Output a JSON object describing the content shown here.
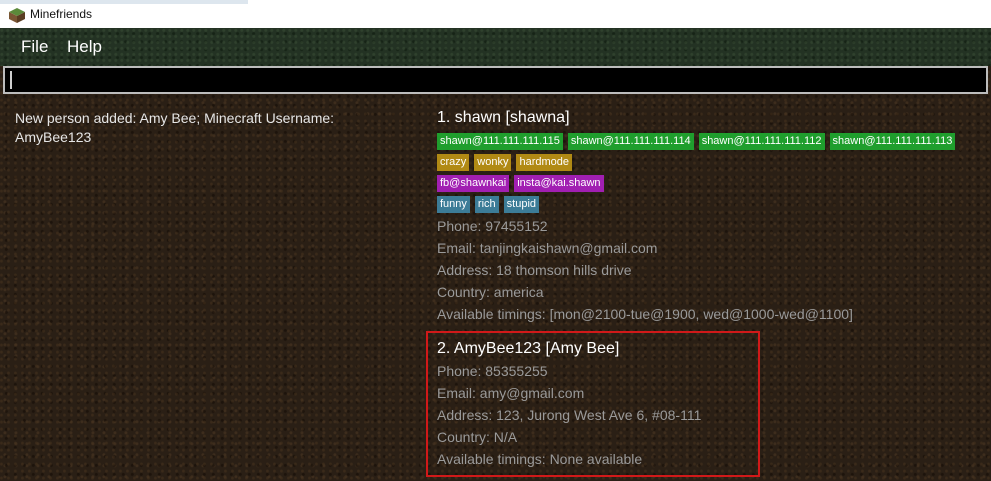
{
  "window": {
    "title": "Minefriends",
    "icon": "grass-block-icon"
  },
  "menu": {
    "items": [
      "File",
      "Help"
    ]
  },
  "command_box": {
    "value": "",
    "placeholder": ""
  },
  "result": {
    "text": "New person added: Amy Bee; Minecraft Username: AmyBee123"
  },
  "persons": [
    {
      "name": "1.  shawn [shawna]",
      "tag_rows": [
        {
          "color": "#1f9e2d",
          "items": [
            "shawn@111.111.111.115",
            "shawn@111.111.111.114",
            "shawn@111.111.111.112",
            "shawn@111.111.111.113"
          ]
        },
        {
          "color": "#b18a14",
          "items": [
            "crazy",
            "wonky",
            "hardmode"
          ]
        },
        {
          "color": "#a11fb2",
          "items": [
            "fb@shawnkai",
            "insta@kai.shawn"
          ]
        },
        {
          "color": "#3c7c97",
          "items": [
            "funny",
            "rich",
            "stupid"
          ]
        }
      ],
      "phone": "Phone: 97455152",
      "email": "Email: tanjingkaishawn@gmail.com",
      "address": "Address: 18 thomson hills drive",
      "country": "Country: america",
      "timings": "Available timings: [mon@2100-tue@1900, wed@1000-wed@1100]"
    },
    {
      "name": "2.  AmyBee123 [Amy Bee]",
      "phone": "Phone: 85355255",
      "email": "Email: amy@gmail.com",
      "address": "Address: 123, Jurong West Ave 6, #08-111",
      "country": "Country: N/A",
      "timings": "Available timings: None available"
    }
  ],
  "colors": {
    "selection_border": "#d11919",
    "background": "#2a1f15",
    "menubar": "#233223"
  }
}
